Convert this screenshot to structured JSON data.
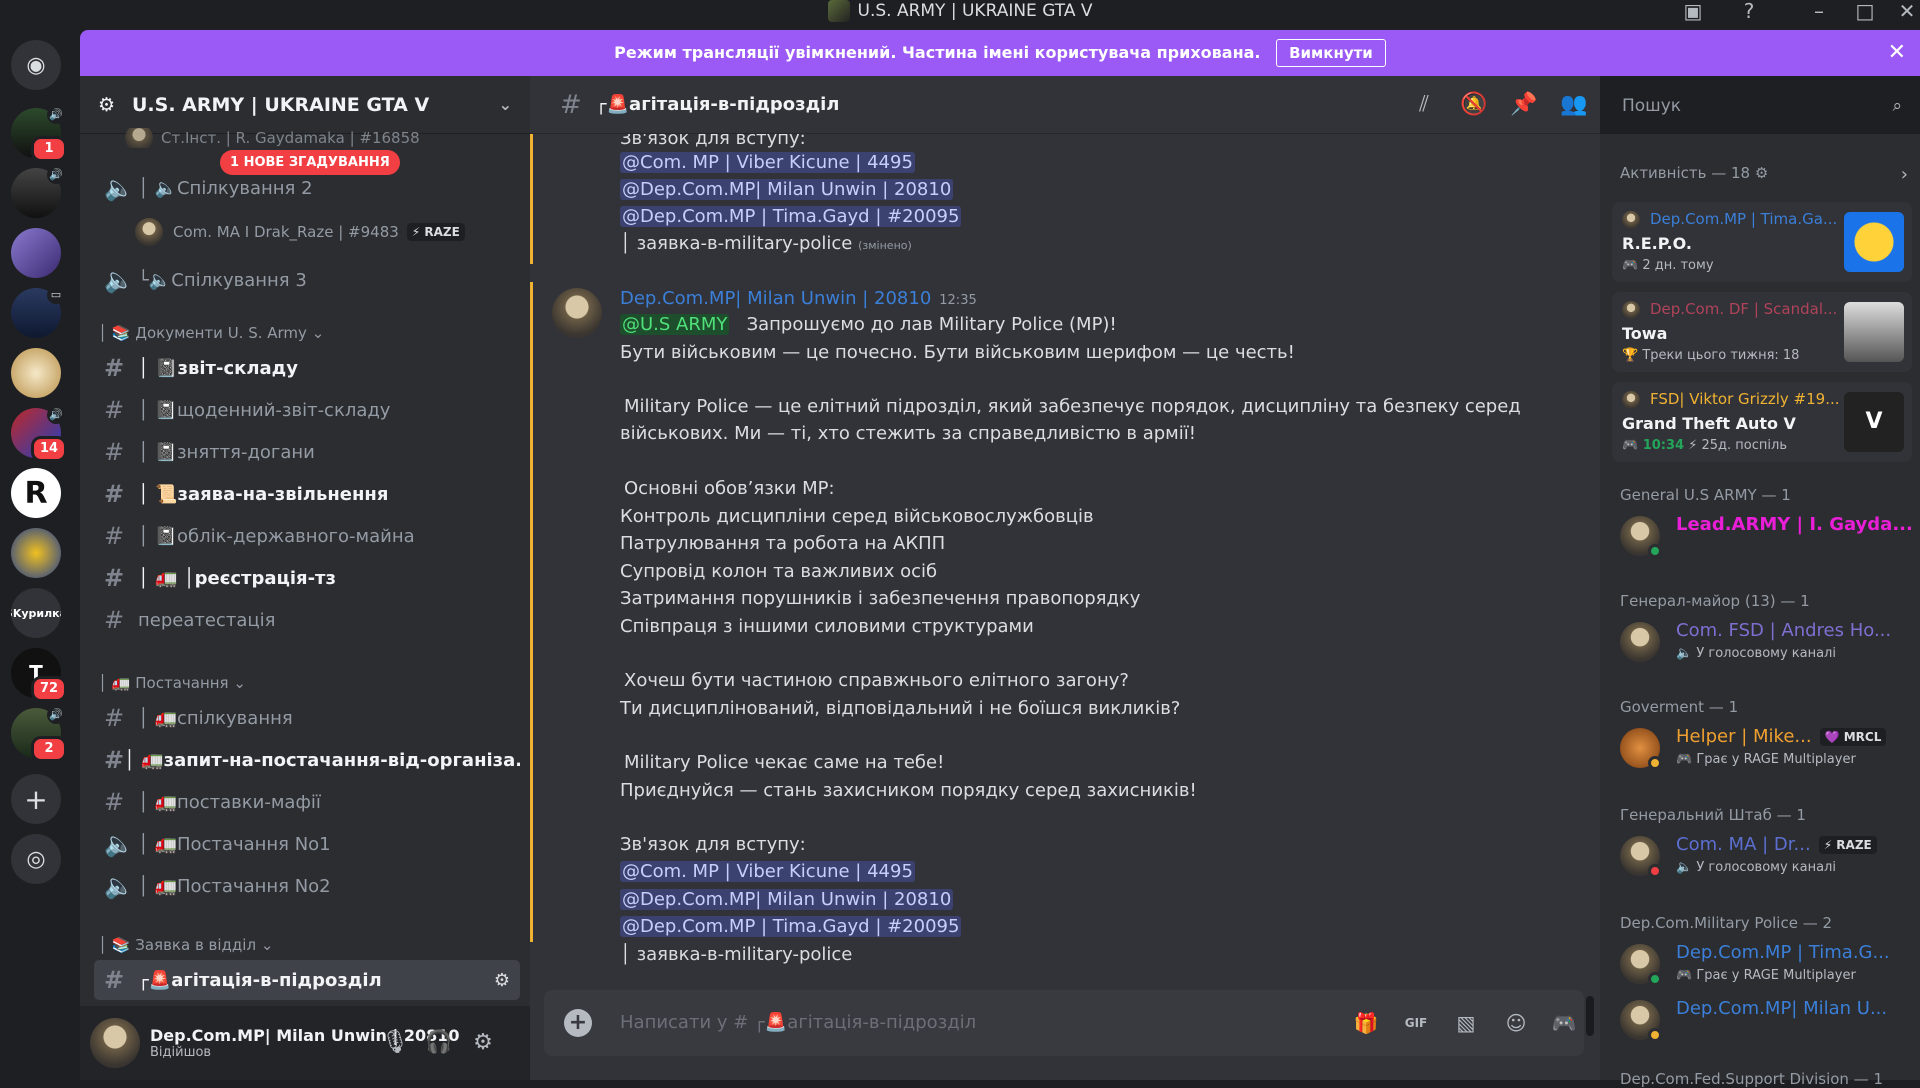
{
  "window": {
    "title": "U.S. ARMY | UKRAINE GTA V"
  },
  "banner": {
    "text": "Режим трансляції увімкнений. Частина імені користувача прихована.",
    "button": "Вимкнути"
  },
  "server": {
    "name": "U.S. ARMY | UKRAINE GTA V"
  },
  "guild_badges": {
    "g1": "1",
    "g6": "14",
    "g10": "72",
    "g11": "2",
    "g9_label": "SKурилка"
  },
  "sidebar": {
    "top_user": "Ст.Інст. | R. Gaydamaka | #16858",
    "mention_pill": "1 НОВЕ ЗГАДУВАННЯ",
    "voice2": "Спілкування 2",
    "voice_user": "Com. MA I Drak_Raze | #9483",
    "voice_user_tag": "RAZE",
    "voice3": "Спілкування 3",
    "cat_docs": "Документи U. S. Army",
    "ch_zvit": "звіт-складу",
    "ch_daily": "щоденний-звіт-складу",
    "ch_dogana": "зняття-догани",
    "ch_zayava": "заява-на-звільнення",
    "ch_oblik": "облік-державного-майна",
    "ch_reg": "реєстрація-тз",
    "ch_perea": "переатестація",
    "cat_supply": "Постачання",
    "ch_spilk": "спілкування",
    "ch_zapyt": "запит-на-постачання-від-організа...",
    "ch_mafia": "поставки-мафії",
    "v_supply1": "Постачання No1",
    "v_supply2": "Постачання No2",
    "cat_apply": "Заявка в відділ",
    "ch_agit": "агітація-в-підрозділ"
  },
  "user_panel": {
    "name": "Dep.Com.MP| Milan Unwin | 20810",
    "status": "Відійшов"
  },
  "chat": {
    "channel": "агітація-в-підрозділ",
    "prev_lines": {
      "l0": "Зв'язок для вступу:",
      "l1": "@Com. MP | Viber Kicune | 4495",
      "l2": "@Dep.Com.MP| Milan Unwin | 20810",
      "l3": "@Dep.Com.MP | Tima.Gayd | #20095",
      "l4": "заявка-в-military-police",
      "edited": "(змінено)"
    },
    "author": "Dep.Com.MP| Milan Unwin | 20810",
    "time": "12:35",
    "msg": {
      "m0_mention": "@U.S ARMY",
      "m0_text": "Запрошуємо до лав Military Police (MP)!",
      "m1": "Бути військовим — це почесно. Бути військовим шерифом — це честь!",
      "m2": "Military Police — це елітний підрозділ, який забезпечує порядок, дисципліну та безпеку серед",
      "m3": "військових. Ми — ті, хто стежить за справедливістю в армії!",
      "m4": "Основні обов’язки МР:",
      "m5": "Контроль дисципліни серед військовослужбовців",
      "m6": "Патрулювання та робота на АКПП",
      "m7": "Супровід колон та важливих осіб",
      "m8": "Затримання порушників і забезпечення правопорядку",
      "m9": "Співпраця з іншими силовими структурами",
      "m10": "Хочеш бути частиною справжнього елітного загону?",
      "m11": "Ти дисциплінований, відповідальний і не боїшся викликів?",
      "m12": "Military Police чекає саме на тебе!",
      "m13": "Приєднуйся — стань захисником порядку серед захисників!",
      "m14": "Зв'язок для вступу:",
      "m15": "@Com. MP | Viber Kicune | 4495",
      "m16": "@Dep.Com.MP| Milan Unwin | 20810",
      "m17": "@Dep.Com.MP | Tima.Gayd | #20095",
      "m18": "заявка-в-military-police"
    },
    "composer_placeholder": "Написати у # ┌🚨агітація-в-підрозділ"
  },
  "search": {
    "placeholder": "Пошук"
  },
  "members": {
    "activity_header": "Активність — 18",
    "cards": [
      {
        "who": "Dep.Com.MP | Tima.Ga...",
        "game": "R.E.P.O.",
        "meta": "2 дн. тому",
        "color": "#3b7fd8"
      },
      {
        "who": "Dep.Com. DF | Scandal...",
        "game": "Towa",
        "meta": "Треки цього тижня: 18",
        "color": "#b0435a"
      },
      {
        "who": "FSD| Viktor Grizzly #19...",
        "game": "Grand Theft Auto V",
        "meta_time": "10:34",
        "meta": "25д. поспіль",
        "color": "#f0b232"
      }
    ],
    "groups": [
      {
        "title": "General U.S ARMY — 1",
        "name": "Lead.ARMY | I. Gayda...",
        "color": "#e91ed7"
      },
      {
        "title": "Генерал-майор (13) — 1",
        "name": "Com. FSD | Andres Ho...",
        "sub": "У голосовому каналі",
        "color": "#7d6fd1"
      },
      {
        "title": "Goverment — 1",
        "name": "Helper | Mike...",
        "tag": "MRCL",
        "sub": "Грає у RAGE Multiplayer",
        "color": "#f0a030"
      },
      {
        "title": "Генеральний Штаб — 1",
        "name": "Com. MA | Dr...",
        "tag": "RAZE",
        "sub": "У голосовому каналі",
        "color": "#5c6fd1"
      },
      {
        "title": "Dep.Com.Military Police — 2",
        "name": "Dep.Com.MP | Tima.G...",
        "sub": "Грає у RAGE Multiplayer",
        "name2": "Dep.Com.MP| Milan U...",
        "color": "#3b7fd8"
      }
    ],
    "last_group": "Dep.Com.Fed.Support Division — 1"
  }
}
